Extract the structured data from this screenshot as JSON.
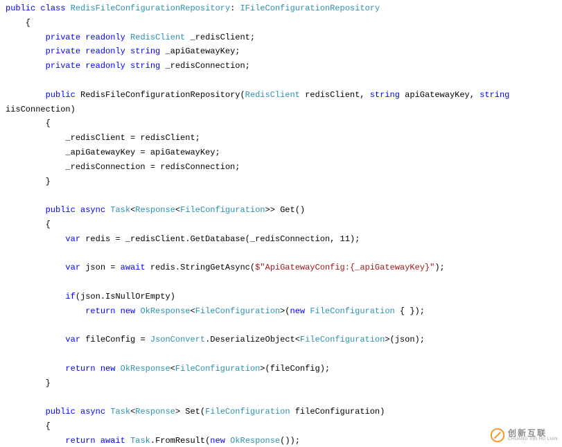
{
  "code": {
    "tokens": [
      [
        {
          "c": "kw",
          "t": "public"
        },
        {
          "t": " "
        },
        {
          "c": "kw",
          "t": "class"
        },
        {
          "t": " "
        },
        {
          "c": "typ",
          "t": "RedisFileConfigurationRepository"
        },
        {
          "t": ": "
        },
        {
          "c": "typ",
          "t": "IFileConfigurationRepository"
        }
      ],
      [
        {
          "t": "    {"
        }
      ],
      [
        {
          "t": "        "
        },
        {
          "c": "kw",
          "t": "private"
        },
        {
          "t": " "
        },
        {
          "c": "kw",
          "t": "readonly"
        },
        {
          "t": " "
        },
        {
          "c": "typ",
          "t": "RedisClient"
        },
        {
          "t": " _redisClient;"
        }
      ],
      [
        {
          "t": "        "
        },
        {
          "c": "kw",
          "t": "private"
        },
        {
          "t": " "
        },
        {
          "c": "kw",
          "t": "readonly"
        },
        {
          "t": " "
        },
        {
          "c": "kw",
          "t": "string"
        },
        {
          "t": " _apiGatewayKey;"
        }
      ],
      [
        {
          "t": "        "
        },
        {
          "c": "kw",
          "t": "private"
        },
        {
          "t": " "
        },
        {
          "c": "kw",
          "t": "readonly"
        },
        {
          "t": " "
        },
        {
          "c": "kw",
          "t": "string"
        },
        {
          "t": " _redisConnection;"
        }
      ],
      [],
      [
        {
          "t": "        "
        },
        {
          "c": "kw",
          "t": "public"
        },
        {
          "t": " RedisFileConfigurationRepository("
        },
        {
          "c": "typ",
          "t": "RedisClient"
        },
        {
          "t": " redisClient, "
        },
        {
          "c": "kw",
          "t": "string"
        },
        {
          "t": " apiGatewayKey, "
        },
        {
          "c": "kw",
          "t": "string"
        }
      ],
      [
        {
          "t": "iisConnection)"
        }
      ],
      [
        {
          "t": "        {"
        }
      ],
      [
        {
          "t": "            _redisClient = redisClient;"
        }
      ],
      [
        {
          "t": "            _apiGatewayKey = apiGatewayKey;"
        }
      ],
      [
        {
          "t": "            _redisConnection = redisConnection;"
        }
      ],
      [
        {
          "t": "        }"
        }
      ],
      [],
      [
        {
          "t": "        "
        },
        {
          "c": "kw",
          "t": "public"
        },
        {
          "t": " "
        },
        {
          "c": "kw",
          "t": "async"
        },
        {
          "t": " "
        },
        {
          "c": "typ",
          "t": "Task"
        },
        {
          "t": "<"
        },
        {
          "c": "typ",
          "t": "Response"
        },
        {
          "t": "<"
        },
        {
          "c": "typ",
          "t": "FileConfiguration"
        },
        {
          "t": ">> Get()"
        }
      ],
      [
        {
          "t": "        {"
        }
      ],
      [
        {
          "t": "            "
        },
        {
          "c": "kw",
          "t": "var"
        },
        {
          "t": " redis = _redisClient.GetDatabase(_redisConnection, 11);"
        }
      ],
      [],
      [
        {
          "t": "            "
        },
        {
          "c": "kw",
          "t": "var"
        },
        {
          "t": " json = "
        },
        {
          "c": "kw",
          "t": "await"
        },
        {
          "t": " redis.StringGetAsync("
        },
        {
          "c": "str",
          "t": "$\"ApiGatewayConfig:{_apiGatewayKey}\""
        },
        {
          "t": ");"
        }
      ],
      [],
      [
        {
          "t": "            "
        },
        {
          "c": "kw",
          "t": "if"
        },
        {
          "t": "(json.IsNullOrEmpty)"
        }
      ],
      [
        {
          "t": "                "
        },
        {
          "c": "kw",
          "t": "return"
        },
        {
          "t": " "
        },
        {
          "c": "kw",
          "t": "new"
        },
        {
          "t": " "
        },
        {
          "c": "typ",
          "t": "OkResponse"
        },
        {
          "t": "<"
        },
        {
          "c": "typ",
          "t": "FileConfiguration"
        },
        {
          "t": ">("
        },
        {
          "c": "kw",
          "t": "new"
        },
        {
          "t": " "
        },
        {
          "c": "typ",
          "t": "FileConfiguration"
        },
        {
          "t": " { });"
        }
      ],
      [],
      [
        {
          "t": "            "
        },
        {
          "c": "kw",
          "t": "var"
        },
        {
          "t": " fileConfig = "
        },
        {
          "c": "typ",
          "t": "JsonConvert"
        },
        {
          "t": ".DeserializeObject<"
        },
        {
          "c": "typ",
          "t": "FileConfiguration"
        },
        {
          "t": ">(json);"
        }
      ],
      [],
      [
        {
          "t": "            "
        },
        {
          "c": "kw",
          "t": "return"
        },
        {
          "t": " "
        },
        {
          "c": "kw",
          "t": "new"
        },
        {
          "t": " "
        },
        {
          "c": "typ",
          "t": "OkResponse"
        },
        {
          "t": "<"
        },
        {
          "c": "typ",
          "t": "FileConfiguration"
        },
        {
          "t": ">(fileConfig);"
        }
      ],
      [
        {
          "t": "        }"
        }
      ],
      [],
      [
        {
          "t": "        "
        },
        {
          "c": "kw",
          "t": "public"
        },
        {
          "t": " "
        },
        {
          "c": "kw",
          "t": "async"
        },
        {
          "t": " "
        },
        {
          "c": "typ",
          "t": "Task"
        },
        {
          "t": "<"
        },
        {
          "c": "typ",
          "t": "Response"
        },
        {
          "t": "> Set("
        },
        {
          "c": "typ",
          "t": "FileConfiguration"
        },
        {
          "t": " fileConfiguration)"
        }
      ],
      [
        {
          "t": "        {"
        }
      ],
      [
        {
          "t": "            "
        },
        {
          "c": "kw",
          "t": "return"
        },
        {
          "t": " "
        },
        {
          "c": "kw",
          "t": "await"
        },
        {
          "t": " "
        },
        {
          "c": "typ",
          "t": "Task"
        },
        {
          "t": ".FromResult("
        },
        {
          "c": "kw",
          "t": "new"
        },
        {
          "t": " "
        },
        {
          "c": "typ",
          "t": "OkResponse"
        },
        {
          "t": "());"
        }
      ]
    ]
  },
  "watermark": {
    "cn": "创新互联",
    "en": "CHUANG XIN HU LIAN"
  }
}
